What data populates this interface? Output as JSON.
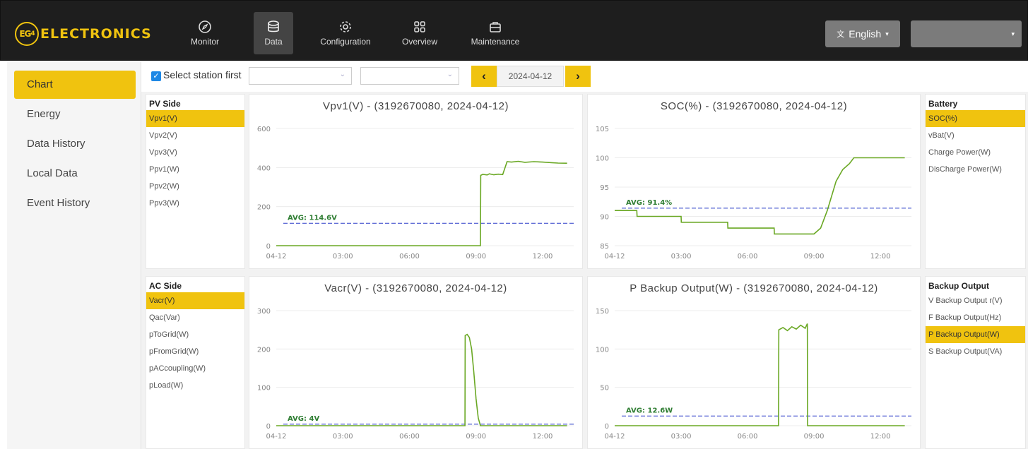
{
  "brand": {
    "logo_mark": "EG",
    "logo_sub": "4",
    "name": "ELECTRONICS"
  },
  "nav": [
    {
      "label": "Monitor",
      "icon": "compass-icon"
    },
    {
      "label": "Data",
      "icon": "database-icon"
    },
    {
      "label": "Configuration",
      "icon": "gear-icon"
    },
    {
      "label": "Overview",
      "icon": "grid-icon"
    },
    {
      "label": "Maintenance",
      "icon": "briefcase-icon"
    }
  ],
  "lang": {
    "label": "English"
  },
  "sidebar": {
    "items": [
      {
        "label": "Chart"
      },
      {
        "label": "Energy"
      },
      {
        "label": "Data History"
      },
      {
        "label": "Local Data"
      },
      {
        "label": "Event History"
      }
    ]
  },
  "toolbar": {
    "checkbox_label": "Select station first",
    "date": "2024-04-12"
  },
  "pv": {
    "title": "PV Side",
    "items": [
      "Vpv1(V)",
      "Vpv2(V)",
      "Vpv3(V)",
      "Ppv1(W)",
      "Ppv2(W)",
      "Ppv3(W)"
    ]
  },
  "battery": {
    "title": "Battery",
    "items": [
      "SOC(%)",
      "vBat(V)",
      "Charge Power(W)",
      "DisCharge Power(W)"
    ]
  },
  "ac": {
    "title": "AC Side",
    "items": [
      "Vacr(V)",
      "Qac(Var)",
      "pToGrid(W)",
      "pFromGrid(W)",
      "pACcoupling(W)",
      "pLoad(W)"
    ]
  },
  "backup": {
    "title": "Backup Output",
    "items": [
      "V Backup Output r(V)",
      "F Backup Output(Hz)",
      "P Backup Output(W)",
      "S Backup Output(VA)"
    ]
  },
  "colors": {
    "accent": "#f0c30f",
    "line": "#6aa824",
    "avg": "#2a3cc8",
    "avg_label": "#2e7d32"
  },
  "chart_data": [
    {
      "type": "line",
      "title": "Vpv1(V) - (3192670080, 2024-04-12)",
      "x_ticks": [
        "04-12",
        "03:00",
        "06:00",
        "09:00",
        "12:00"
      ],
      "y_ticks": [
        "0",
        "200",
        "400",
        "600"
      ],
      "ylim": [
        0,
        600
      ],
      "xlim": [
        0,
        13.4
      ],
      "avg_label": "AVG: 114.6V",
      "avg": 114.6,
      "x": [
        0,
        9.2,
        9.21,
        9.3,
        9.5,
        9.6,
        9.8,
        10,
        10.2,
        10.4,
        10.6,
        10.9,
        11.2,
        11.6,
        12,
        12.4,
        12.7,
        13.1
      ],
      "values": [
        0,
        0,
        360,
        365,
        362,
        368,
        363,
        366,
        364,
        430,
        428,
        432,
        427,
        430,
        428,
        425,
        423,
        422
      ]
    },
    {
      "type": "line",
      "title": "SOC(%) - (3192670080, 2024-04-12)",
      "x_ticks": [
        "04-12",
        "03:00",
        "06:00",
        "09:00",
        "12:00"
      ],
      "y_ticks": [
        "85",
        "90",
        "95",
        "100",
        "105"
      ],
      "ylim": [
        85,
        105
      ],
      "xlim": [
        0,
        13.4
      ],
      "avg_label": "AVG: 91.4%",
      "avg": 91.4,
      "x": [
        0,
        1.0,
        1.01,
        3.0,
        3.01,
        5.1,
        5.11,
        7.2,
        7.21,
        9.0,
        9.3,
        9.6,
        10,
        10.3,
        10.6,
        10.8,
        11,
        11.5,
        12,
        13.1
      ],
      "values": [
        91,
        91,
        90,
        90,
        89,
        89,
        88,
        88,
        87,
        87,
        88,
        91,
        96,
        98,
        99,
        100,
        100,
        100,
        100,
        100
      ]
    },
    {
      "type": "line",
      "title": "Vacr(V) - (3192670080, 2024-04-12)",
      "x_ticks": [
        "04-12",
        "03:00",
        "06:00",
        "09:00",
        "12:00"
      ],
      "y_ticks": [
        "0",
        "100",
        "200",
        "300"
      ],
      "ylim": [
        0,
        300
      ],
      "xlim": [
        0,
        13.4
      ],
      "avg_label": "AVG: 4V",
      "avg": 4,
      "x": [
        0,
        8.5,
        8.51,
        8.6,
        8.7,
        8.8,
        8.9,
        9.0,
        9.1,
        9.2,
        13.1
      ],
      "values": [
        0,
        0,
        235,
        238,
        230,
        200,
        140,
        70,
        20,
        0,
        0
      ]
    },
    {
      "type": "line",
      "title": "P Backup Output(W) - (3192670080, 2024-04-12)",
      "x_ticks": [
        "04-12",
        "03:00",
        "06:00",
        "09:00",
        "12:00"
      ],
      "y_ticks": [
        "0",
        "50",
        "100",
        "150"
      ],
      "ylim": [
        0,
        150
      ],
      "xlim": [
        0,
        13.4
      ],
      "avg_label": "AVG: 12.6W",
      "avg": 12.6,
      "x": [
        0,
        7.4,
        7.41,
        7.6,
        7.8,
        8.0,
        8.2,
        8.4,
        8.6,
        8.7,
        8.71,
        13.1
      ],
      "values": [
        0,
        0,
        125,
        128,
        124,
        129,
        126,
        131,
        127,
        133,
        0,
        0
      ]
    }
  ]
}
